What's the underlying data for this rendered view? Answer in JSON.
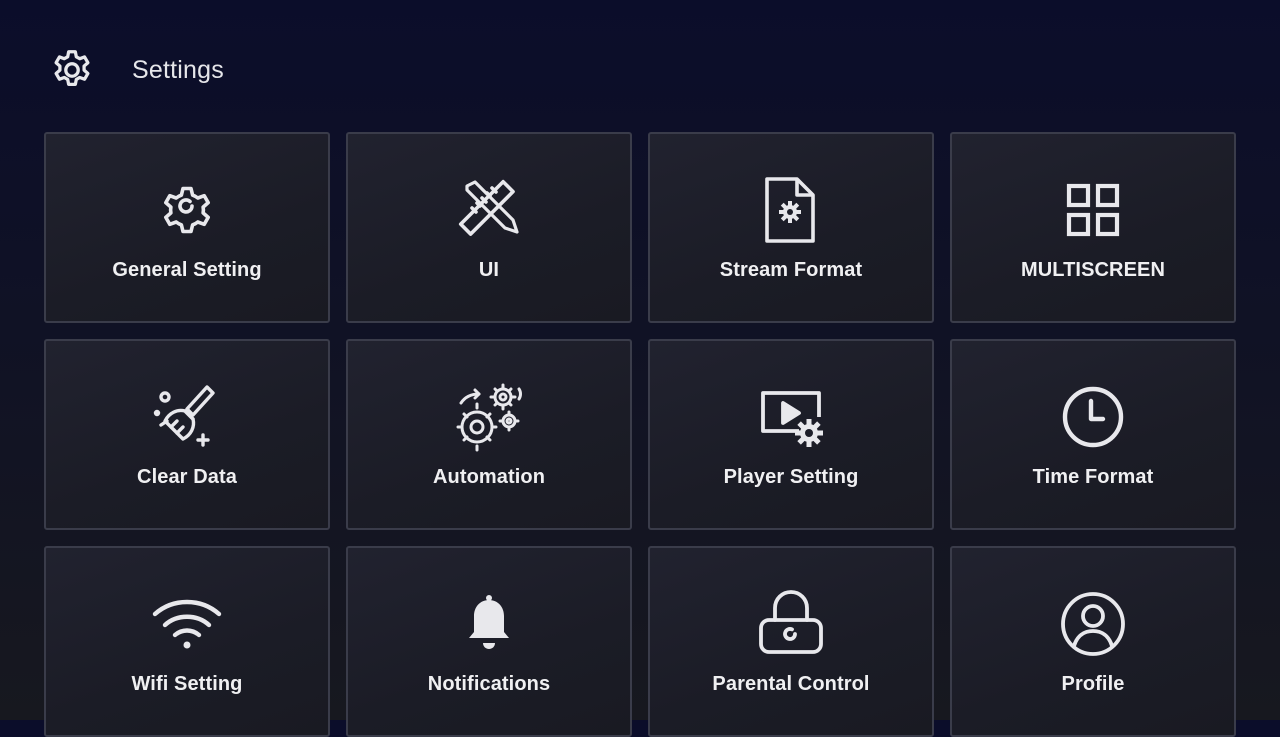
{
  "header": {
    "icon": "gear-icon",
    "title": "Settings"
  },
  "tiles": [
    {
      "label": "General Setting",
      "icon": "gear-icon"
    },
    {
      "label": "UI",
      "icon": "ruler-pencil-icon"
    },
    {
      "label": "Stream Format",
      "icon": "file-settings-icon"
    },
    {
      "label": "MULTISCREEN",
      "icon": "grid-icon"
    },
    {
      "label": "Clear Data",
      "icon": "broom-icon"
    },
    {
      "label": "Automation",
      "icon": "gears-automation-icon"
    },
    {
      "label": "Player Setting",
      "icon": "video-settings-icon"
    },
    {
      "label": "Time Format",
      "icon": "clock-icon"
    },
    {
      "label": "Wifi Setting",
      "icon": "wifi-icon"
    },
    {
      "label": "Notifications",
      "icon": "bell-icon"
    },
    {
      "label": "Parental Control",
      "icon": "lock-icon"
    },
    {
      "label": "Profile",
      "icon": "user-circle-icon"
    }
  ],
  "colors": {
    "background_top": "#0b0d2a",
    "tile_border": "#3a3c4a",
    "tile_fill": "#1f202b",
    "icon_stroke": "#e8e8ec"
  }
}
